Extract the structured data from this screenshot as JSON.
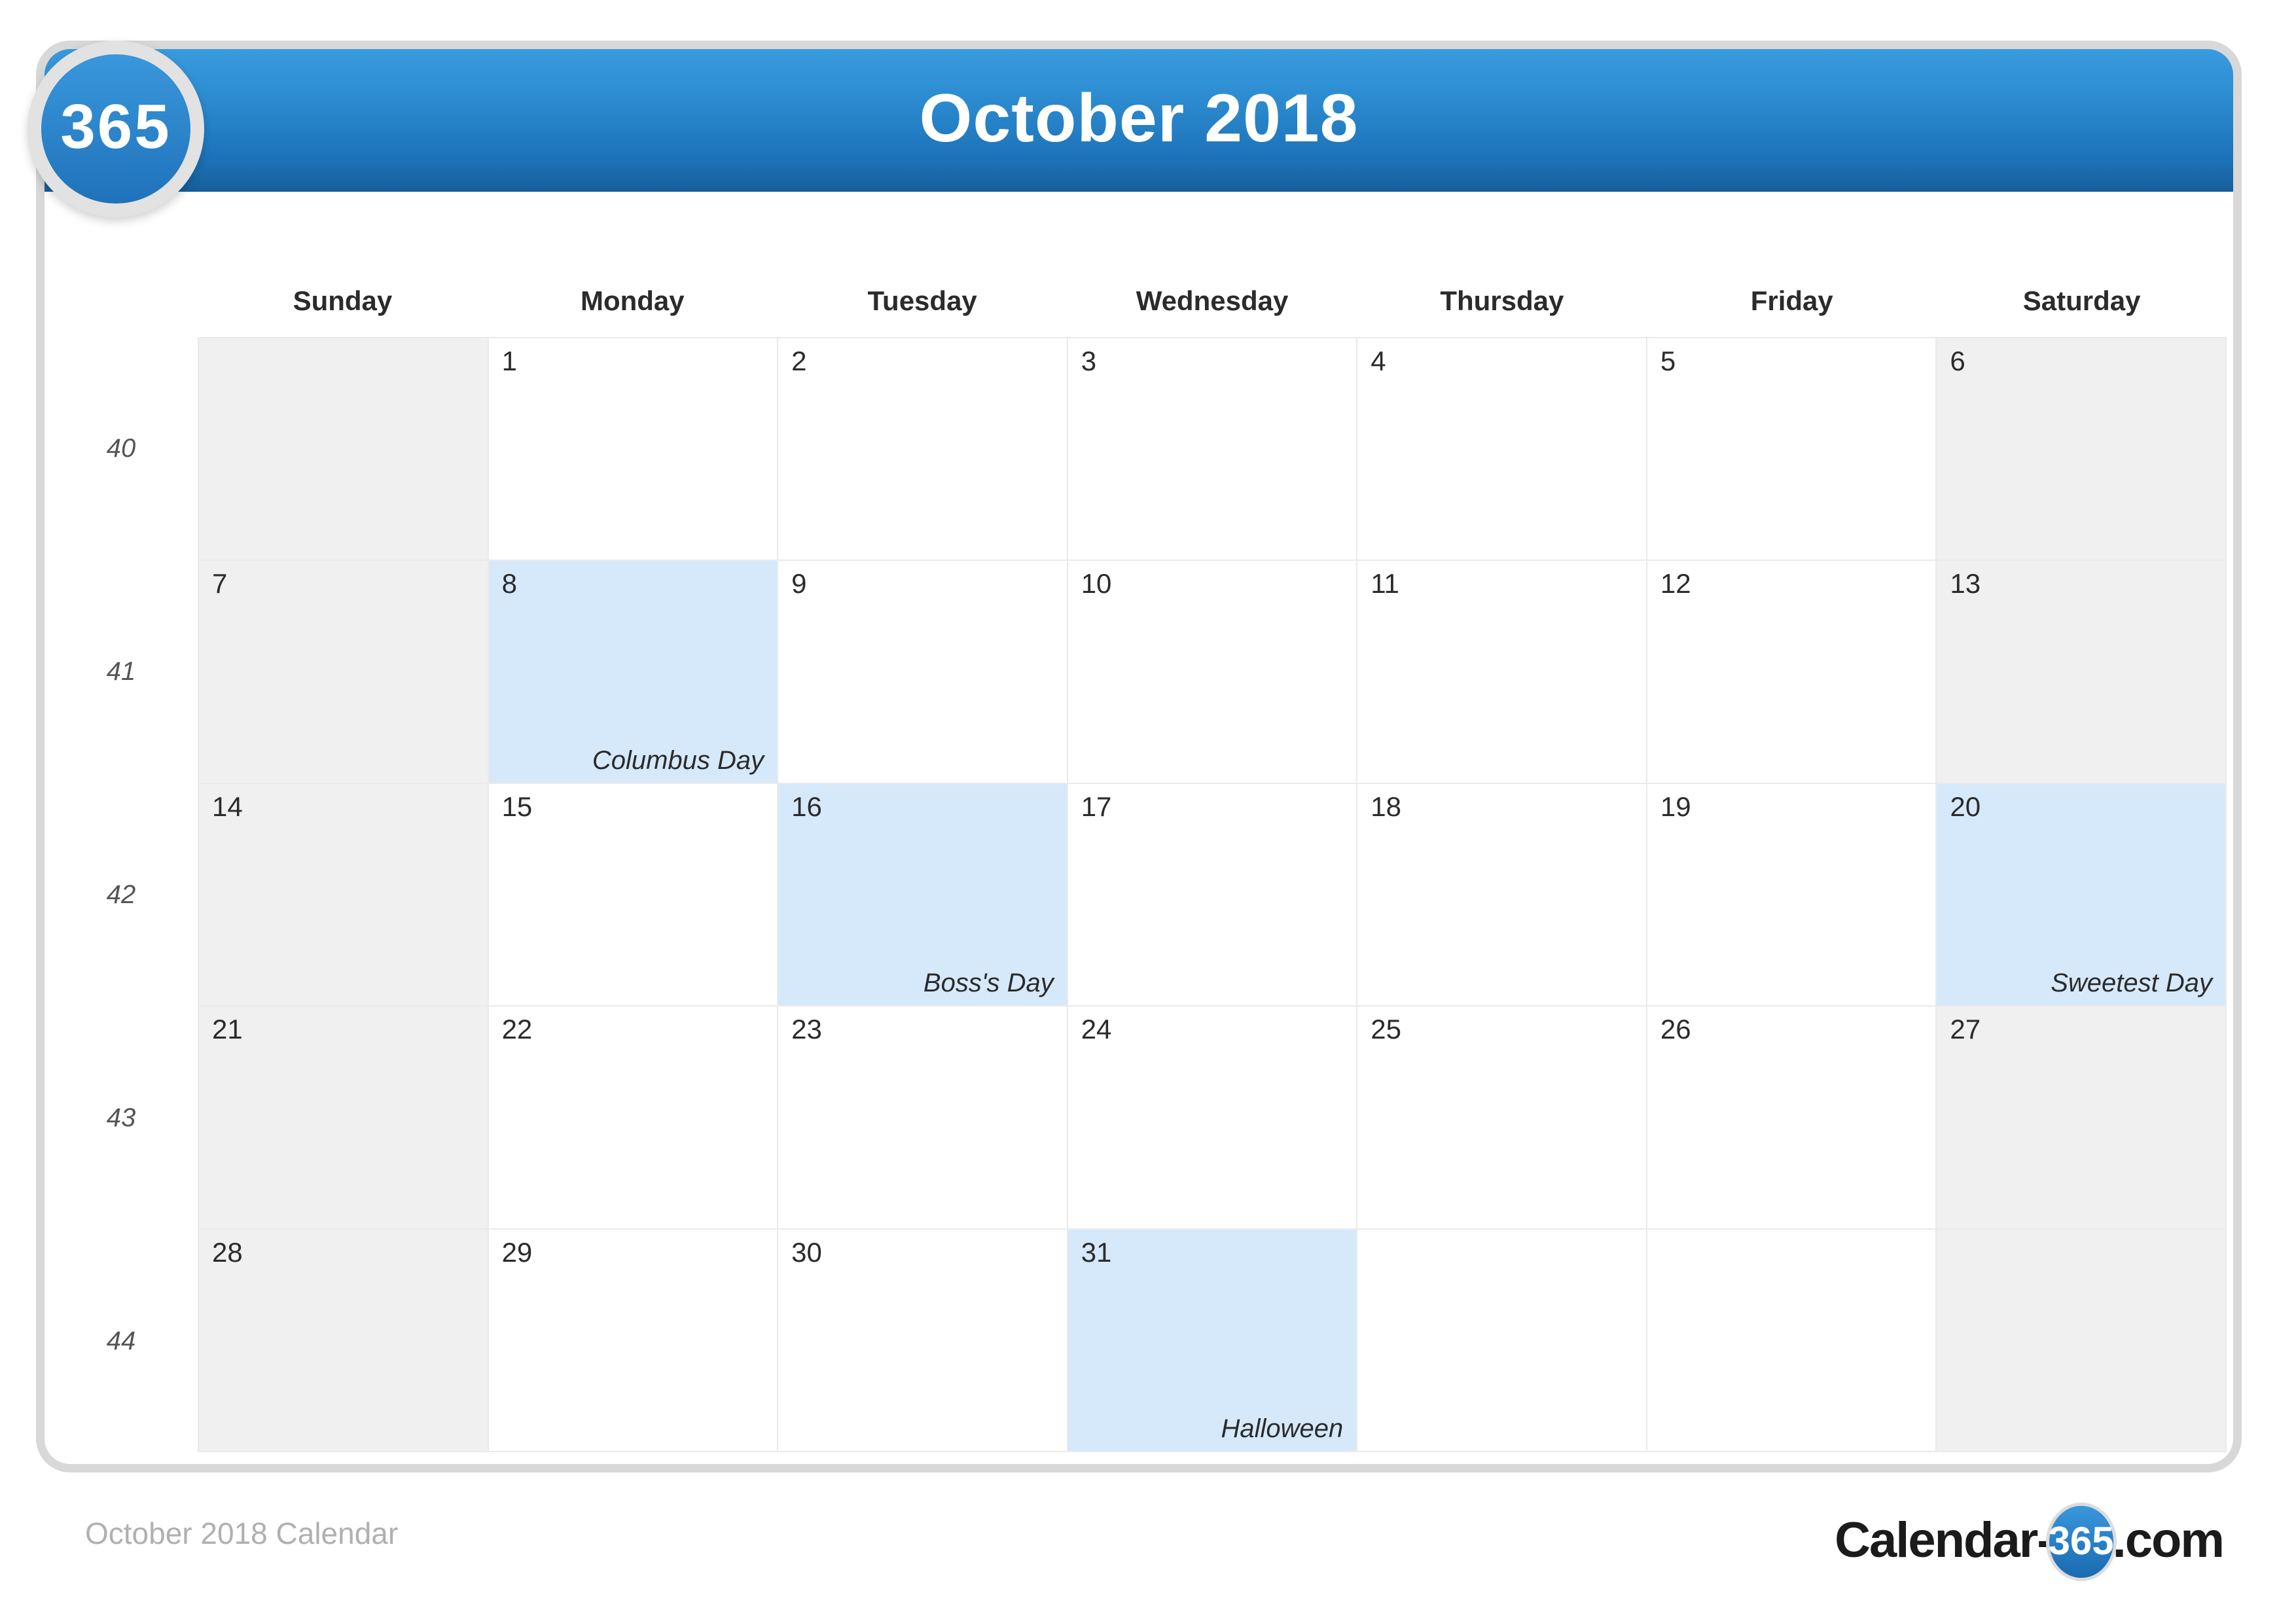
{
  "badge": {
    "label": "365"
  },
  "header": {
    "title": "October 2018"
  },
  "watermark": {
    "text": "365"
  },
  "weekdays": [
    "Sunday",
    "Monday",
    "Tuesday",
    "Wednesday",
    "Thursday",
    "Friday",
    "Saturday"
  ],
  "week_numbers": [
    "40",
    "41",
    "42",
    "43",
    "44"
  ],
  "colors": {
    "header_blue_top": "#3a9ade",
    "header_blue_bottom": "#175e9a",
    "holiday_highlight": "#d6e9fb",
    "weekend_shade": "#f0f0f0",
    "card_border": "#d8d8d8",
    "grid_line": "#eaeaea",
    "watermark": "#f2f2f2"
  },
  "weeks": [
    {
      "number": "40",
      "days": [
        {
          "day": "",
          "holiday": "",
          "weekend": true,
          "blank": true
        },
        {
          "day": "1",
          "holiday": "",
          "weekend": false,
          "blank": false
        },
        {
          "day": "2",
          "holiday": "",
          "weekend": false,
          "blank": false
        },
        {
          "day": "3",
          "holiday": "",
          "weekend": false,
          "blank": false
        },
        {
          "day": "4",
          "holiday": "",
          "weekend": false,
          "blank": false
        },
        {
          "day": "5",
          "holiday": "",
          "weekend": false,
          "blank": false
        },
        {
          "day": "6",
          "holiday": "",
          "weekend": true,
          "blank": false
        }
      ]
    },
    {
      "number": "41",
      "days": [
        {
          "day": "7",
          "holiday": "",
          "weekend": true,
          "blank": false
        },
        {
          "day": "8",
          "holiday": "Columbus Day",
          "weekend": false,
          "blank": false
        },
        {
          "day": "9",
          "holiday": "",
          "weekend": false,
          "blank": false
        },
        {
          "day": "10",
          "holiday": "",
          "weekend": false,
          "blank": false
        },
        {
          "day": "11",
          "holiday": "",
          "weekend": false,
          "blank": false
        },
        {
          "day": "12",
          "holiday": "",
          "weekend": false,
          "blank": false
        },
        {
          "day": "13",
          "holiday": "",
          "weekend": true,
          "blank": false
        }
      ]
    },
    {
      "number": "42",
      "days": [
        {
          "day": "14",
          "holiday": "",
          "weekend": true,
          "blank": false
        },
        {
          "day": "15",
          "holiday": "",
          "weekend": false,
          "blank": false
        },
        {
          "day": "16",
          "holiday": "Boss's Day",
          "weekend": false,
          "blank": false
        },
        {
          "day": "17",
          "holiday": "",
          "weekend": false,
          "blank": false
        },
        {
          "day": "18",
          "holiday": "",
          "weekend": false,
          "blank": false
        },
        {
          "day": "19",
          "holiday": "",
          "weekend": false,
          "blank": false
        },
        {
          "day": "20",
          "holiday": "Sweetest Day",
          "weekend": true,
          "blank": false
        }
      ]
    },
    {
      "number": "43",
      "days": [
        {
          "day": "21",
          "holiday": "",
          "weekend": true,
          "blank": false
        },
        {
          "day": "22",
          "holiday": "",
          "weekend": false,
          "blank": false
        },
        {
          "day": "23",
          "holiday": "",
          "weekend": false,
          "blank": false
        },
        {
          "day": "24",
          "holiday": "",
          "weekend": false,
          "blank": false
        },
        {
          "day": "25",
          "holiday": "",
          "weekend": false,
          "blank": false
        },
        {
          "day": "26",
          "holiday": "",
          "weekend": false,
          "blank": false
        },
        {
          "day": "27",
          "holiday": "",
          "weekend": true,
          "blank": false
        }
      ]
    },
    {
      "number": "44",
      "days": [
        {
          "day": "28",
          "holiday": "",
          "weekend": true,
          "blank": false
        },
        {
          "day": "29",
          "holiday": "",
          "weekend": false,
          "blank": false
        },
        {
          "day": "30",
          "holiday": "",
          "weekend": false,
          "blank": false
        },
        {
          "day": "31",
          "holiday": "Halloween",
          "weekend": false,
          "blank": false
        },
        {
          "day": "",
          "holiday": "",
          "weekend": false,
          "blank": true
        },
        {
          "day": "",
          "holiday": "",
          "weekend": false,
          "blank": true
        },
        {
          "day": "",
          "holiday": "",
          "weekend": true,
          "blank": true
        }
      ]
    }
  ],
  "footer": {
    "text": "October 2018 Calendar",
    "logo_prefix": "Calendar-",
    "logo_badge": "365",
    "logo_suffix": ".com"
  }
}
